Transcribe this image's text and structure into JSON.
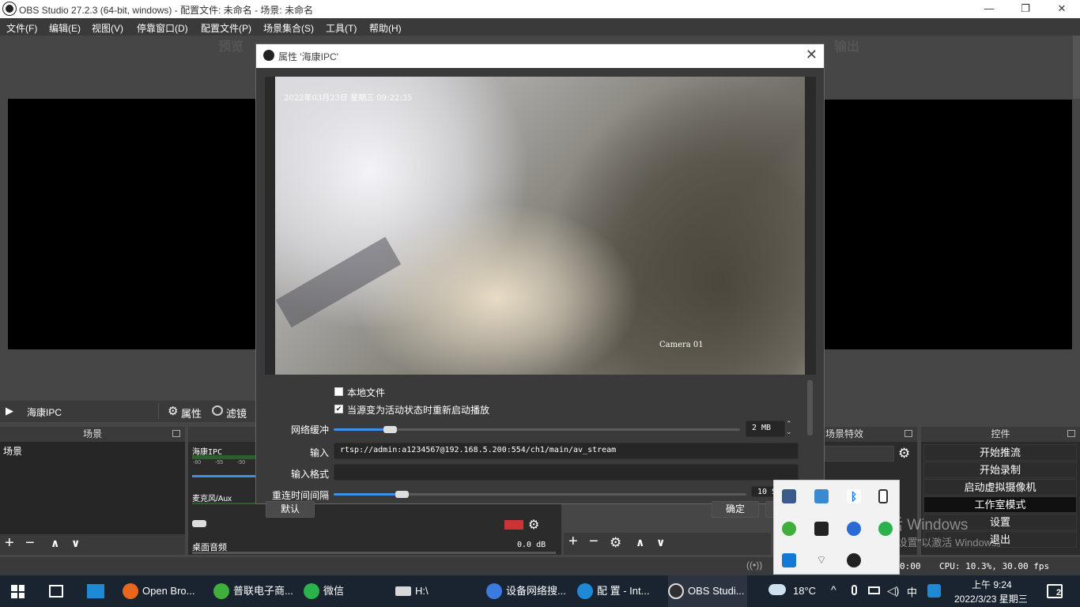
{
  "window": {
    "title": "OBS Studio 27.2.3 (64-bit, windows) - 配置文件: 未命名 - 场景: 未命名",
    "minimize": "—",
    "restore": "❐",
    "close": "✕"
  },
  "menu": [
    "文件(F)",
    "编辑(E)",
    "视图(V)",
    "停靠窗口(D)",
    "配置文件(P)",
    "场景集合(S)",
    "工具(T)",
    "帮助(H)"
  ],
  "preview": {
    "preview_label": "预览",
    "output_label": "输出"
  },
  "source_bar": {
    "play": "▶",
    "source_name": "海康IPC",
    "properties_label": "属性",
    "filters_label": "滤镜"
  },
  "panels": {
    "scenes": {
      "header": "场景",
      "items": [
        "场景"
      ]
    },
    "mixer": {
      "channels": [
        {
          "name": "海康IPC"
        },
        {
          "name": "麦克风/Aux"
        },
        {
          "name": "桌面音频",
          "db": "0.0 dB"
        }
      ],
      "ticks": [
        "-60",
        "-55",
        "-50"
      ]
    },
    "transitions": {
      "header": "场景特效"
    },
    "controls": {
      "header": "控件",
      "buttons": [
        "开始推流",
        "开始录制",
        "启动虚拟摄像机",
        "工作室模式",
        "设置",
        "退出"
      ]
    }
  },
  "toolbar_icons": {
    "add": "+",
    "remove": "−",
    "gear": "⚙",
    "up": "∧",
    "down": "∨"
  },
  "dialog": {
    "title": "属性 '海康IPC'",
    "close": "✕",
    "video_overlay": {
      "timestamp": "2022年03月23日  星期三  09:22:35",
      "camera": "Camera 01"
    },
    "local_file": {
      "label": "本地文件",
      "checked": false
    },
    "restart_on_active": {
      "label": "当源变为活动状态时重新启动播放",
      "checked": true
    },
    "network_buffer": {
      "label": "网络缓冲",
      "value": "2 MB",
      "fraction": 0.14
    },
    "input": {
      "label": "输入",
      "value": "rtsp://admin:a1234567@192.168.5.200:554/ch1/main/av_stream"
    },
    "input_format": {
      "label": "输入格式",
      "value": ""
    },
    "reconnect": {
      "label": "重连时间间隔",
      "value": "10 S",
      "fraction": 0.17
    },
    "defaults_btn": "默认",
    "ok_btn": "确定"
  },
  "status_bar": {
    "time": "0:00",
    "cpu": "CPU: 10.3%, 30.00 fps"
  },
  "watermark": {
    "line1": "激活 Windows",
    "line2": "转到\"设置\"以激活 Windows。"
  },
  "taskbar": {
    "apps": [
      {
        "label": "Open Bro...",
        "color": "#e8661d"
      },
      {
        "label": "普联电子商...",
        "color": "#3fae3a"
      },
      {
        "label": "微信",
        "color": "#2bb24c"
      },
      {
        "label": "H:\\",
        "color": "#d8d8d8"
      },
      {
        "label": "设备网络搜...",
        "color": "#3b7be0"
      },
      {
        "label": "配 置 - Int...",
        "color": "#1e8ad6"
      },
      {
        "label": "OBS Studi...",
        "color": "#303030"
      }
    ],
    "weather": "18°C",
    "ime": "中",
    "clock_time": "上午 9:24",
    "clock_date": "2022/3/23 星期三",
    "notifications": "2"
  },
  "colors": {
    "accent": "#3f8eea",
    "background": "#464646",
    "panel": "#3a3a3a"
  }
}
